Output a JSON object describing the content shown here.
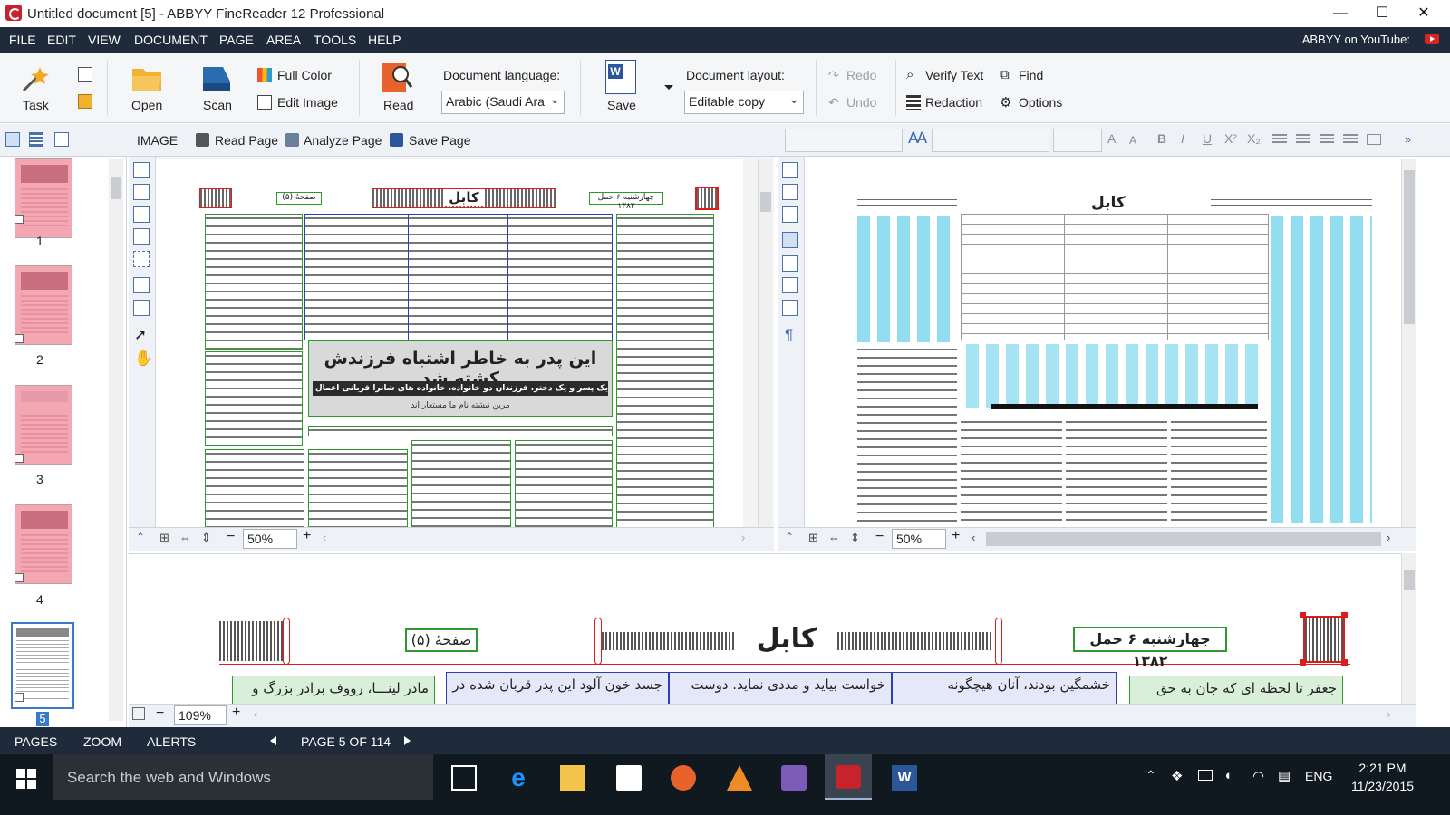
{
  "window": {
    "title": "Untitled document [5] - ABBYY FineReader 12 Professional",
    "minimize_glyph": "—",
    "maximize_glyph": "☐",
    "close_glyph": "✕"
  },
  "menu": {
    "items": [
      "FILE",
      "EDIT",
      "VIEW",
      "DOCUMENT",
      "PAGE",
      "AREA",
      "TOOLS",
      "HELP"
    ],
    "youtube_label": "ABBYY on YouTube:"
  },
  "ribbon": {
    "task": "Task",
    "open": "Open",
    "scan": "Scan",
    "full_color": "Full Color",
    "edit_image": "Edit Image",
    "read": "Read",
    "doc_language_label": "Document language:",
    "doc_language_value": "Arabic (Saudi Ara",
    "save": "Save",
    "doc_layout_label": "Document layout:",
    "doc_layout_value": "Editable copy",
    "redo": "Redo",
    "undo": "Undo",
    "verify_text": "Verify Text",
    "redaction": "Redaction",
    "find": "Find",
    "options": "Options"
  },
  "image_toolbar": {
    "image": "IMAGE",
    "read_page": "Read Page",
    "analyze_page": "Analyze Page",
    "save_page": "Save Page"
  },
  "format_toolbar": {
    "buttons": [
      "A",
      "A",
      "B",
      "I",
      "U",
      "X²",
      "X₂"
    ]
  },
  "pages": {
    "numbers": [
      "1",
      "2",
      "3",
      "4",
      "5"
    ],
    "selected": "5"
  },
  "zoom": {
    "image_pane": "50%",
    "text_pane": "50%",
    "zoom_pane": "109%"
  },
  "document": {
    "page_label": "صفحهٔ (۵)",
    "masthead": "کابل",
    "date_label": "چهارشنبه ۶ حمل ۱۳۸۲",
    "headline": "این پدر به خاطر اشتباه فرزندش کشته شد",
    "subheadline": "یک پسر و یک دختر، فرزندان دو خانواده، خانواده های شانرا قربانی اعمال ناپسند شان کردند",
    "byline": "مرین نبشته نام ما مستعار اند",
    "zoom_col1": "مادر لینـــا، رووف برادر بزرگ و",
    "zoom_col2": "جسد خون آلود این پدر قربان شده در",
    "zoom_col3": "خواست بیاید و مددی نماید. دوست",
    "zoom_col4": "خشمگین بودند، آنان هیچگونه",
    "zoom_col5": "جعفر تا لحظه ای که جان به حق"
  },
  "statusbar": {
    "pages": "PAGES",
    "zoom": "ZOOM",
    "alerts": "ALERTS",
    "page_counter": "PAGE 5 OF 114"
  },
  "taskbar": {
    "search_placeholder": "Search the web and Windows",
    "language": "ENG",
    "time": "2:21 PM",
    "date": "11/23/2015"
  },
  "colors": {
    "menu_bg": "#1f2a3a",
    "taskbar_bg": "#101820",
    "region_green": "#2e9a2e",
    "region_blue": "#2c3fb5",
    "region_red": "#e01b1b",
    "app_red": "#c8232c"
  }
}
